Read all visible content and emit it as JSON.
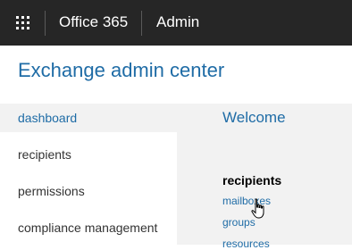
{
  "topbar": {
    "app_name": "Office 365",
    "section": "Admin",
    "waffle_icon": "app-launcher-icon"
  },
  "page": {
    "heading": "Exchange admin center"
  },
  "sidebar": {
    "items": [
      {
        "label": "dashboard",
        "active": true
      },
      {
        "label": "recipients",
        "active": false
      },
      {
        "label": "permissions",
        "active": false
      },
      {
        "label": "compliance management",
        "active": false
      }
    ]
  },
  "main": {
    "welcome": "Welcome",
    "recipients_heading": "recipients",
    "links": [
      "mailboxes",
      "groups",
      "resources"
    ]
  },
  "colors": {
    "topbar": "#262626",
    "accent": "#1f6ca6",
    "content_bg": "#f2f2f2"
  }
}
